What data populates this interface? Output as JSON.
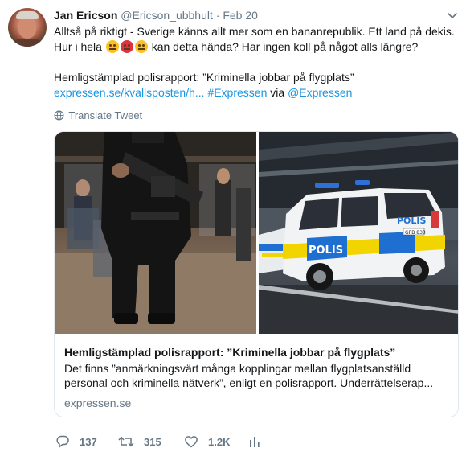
{
  "tweet": {
    "author_name": "Jan Ericson",
    "author_handle": "@Ericson_ubbhult",
    "separator": "·",
    "time": "Feb 20",
    "line1": "Alltså på riktigt - Sverige känns allt mer som en bananrepublik. Ett land på dekis.",
    "line2_prefix": "Hur i hela",
    "line2_suffix": "kan detta hända? Har ingen koll på något alls längre?",
    "line3": "Hemligstämplad polisrapport: ”Kriminella jobbar på flygplats”",
    "link_url": "expressen.se/kvallsposten/h...",
    "hashtag": "#Expressen",
    "via_word": "via",
    "mention": "@Expressen",
    "translate_label": "Translate Tweet"
  },
  "card": {
    "title": "Hemligstämplad polisrapport: ”Kriminella jobbar på flygplats”",
    "desc_line1": "Det finns ”anmärkningsvärt många kopplingar mellan flygplatsanställd",
    "desc_line2": "personal och kriminella nätverk”, enligt en polisrapport. Underrättelserap...",
    "domain": "expressen.se",
    "van_text": "POLIS",
    "van_plate": "GPB 833"
  },
  "actions": {
    "reply_count": "137",
    "retweet_count": "315",
    "like_count": "1.2K"
  },
  "icons": [
    "chevron-down-icon",
    "globe-icon",
    "reply-icon",
    "retweet-icon",
    "like-icon",
    "analytics-icon"
  ],
  "colors": {
    "link": "#1b95e0",
    "muted": "#657786",
    "text": "#14171a",
    "border": "#e1e8ed"
  }
}
